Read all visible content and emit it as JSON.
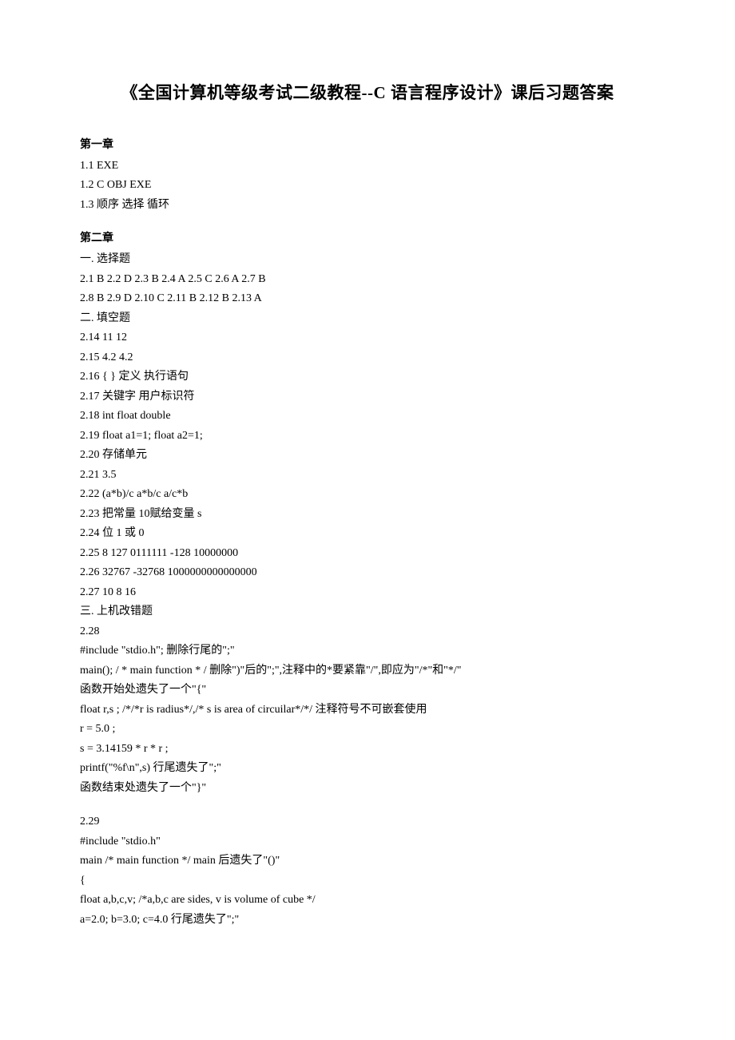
{
  "title": "《全国计算机等级考试二级教程--C 语言程序设计》课后习题答案",
  "chapter1": {
    "header": "第一章",
    "lines": [
      "1.1 EXE",
      "1.2 C OBJ EXE",
      "1.3 顺序 选择 循环"
    ]
  },
  "chapter2": {
    "header": "第二章",
    "sec1_header": "一. 选择题",
    "sec1_lines": [
      "2.1 B 2.2 D 2.3 B 2.4 A 2.5 C 2.6 A 2.7 B",
      "2.8 B 2.9 D 2.10 C 2.11 B 2.12 B 2.13 A"
    ],
    "sec2_header": "二. 填空题",
    "sec2_lines": [
      "2.14 11 12",
      "2.15 4.2 4.2",
      "2.16 { } 定义 执行语句",
      "2.17 关键字 用户标识符",
      "2.18 int float double",
      "2.19 float a1=1; float a2=1;",
      "2.20 存储单元",
      "2.21 3.5",
      "2.22 (a*b)/c a*b/c a/c*b",
      "2.23 把常量 10赋给变量 s",
      "2.24 位 1 或 0",
      "2.25 8 127 0111111 -128 10000000",
      "2.26 32767 -32768 1000000000000000",
      "2.27 10 8 16"
    ],
    "sec3_header": "三. 上机改错题",
    "ex228_header": "2.28",
    "ex228_lines": [
      "#include \"stdio.h\"; 删除行尾的\";\"",
      "main(); / * main function * / 删除\")\"后的\";\",注释中的*要紧靠\"/\",即应为\"/*\"和\"*/\"",
      "函数开始处遗失了一个\"{\"",
      "float r,s ; /*/*r is radius*/,/* s is area of circuilar*/*/ 注释符号不可嵌套使用",
      "r = 5.0 ;",
      "s = 3.14159 * r * r ;",
      "printf(\"%f\\n\",s) 行尾遗失了\";\"",
      "函数结束处遗失了一个\"}\""
    ],
    "ex229_header": "2.29",
    "ex229_lines": [
      "#include \"stdio.h\"",
      "main /* main function */ main 后遗失了\"()\"",
      "{",
      "float a,b,c,v; /*a,b,c are sides, v is volume of cube */",
      "a=2.0; b=3.0; c=4.0 行尾遗失了\";\""
    ]
  }
}
